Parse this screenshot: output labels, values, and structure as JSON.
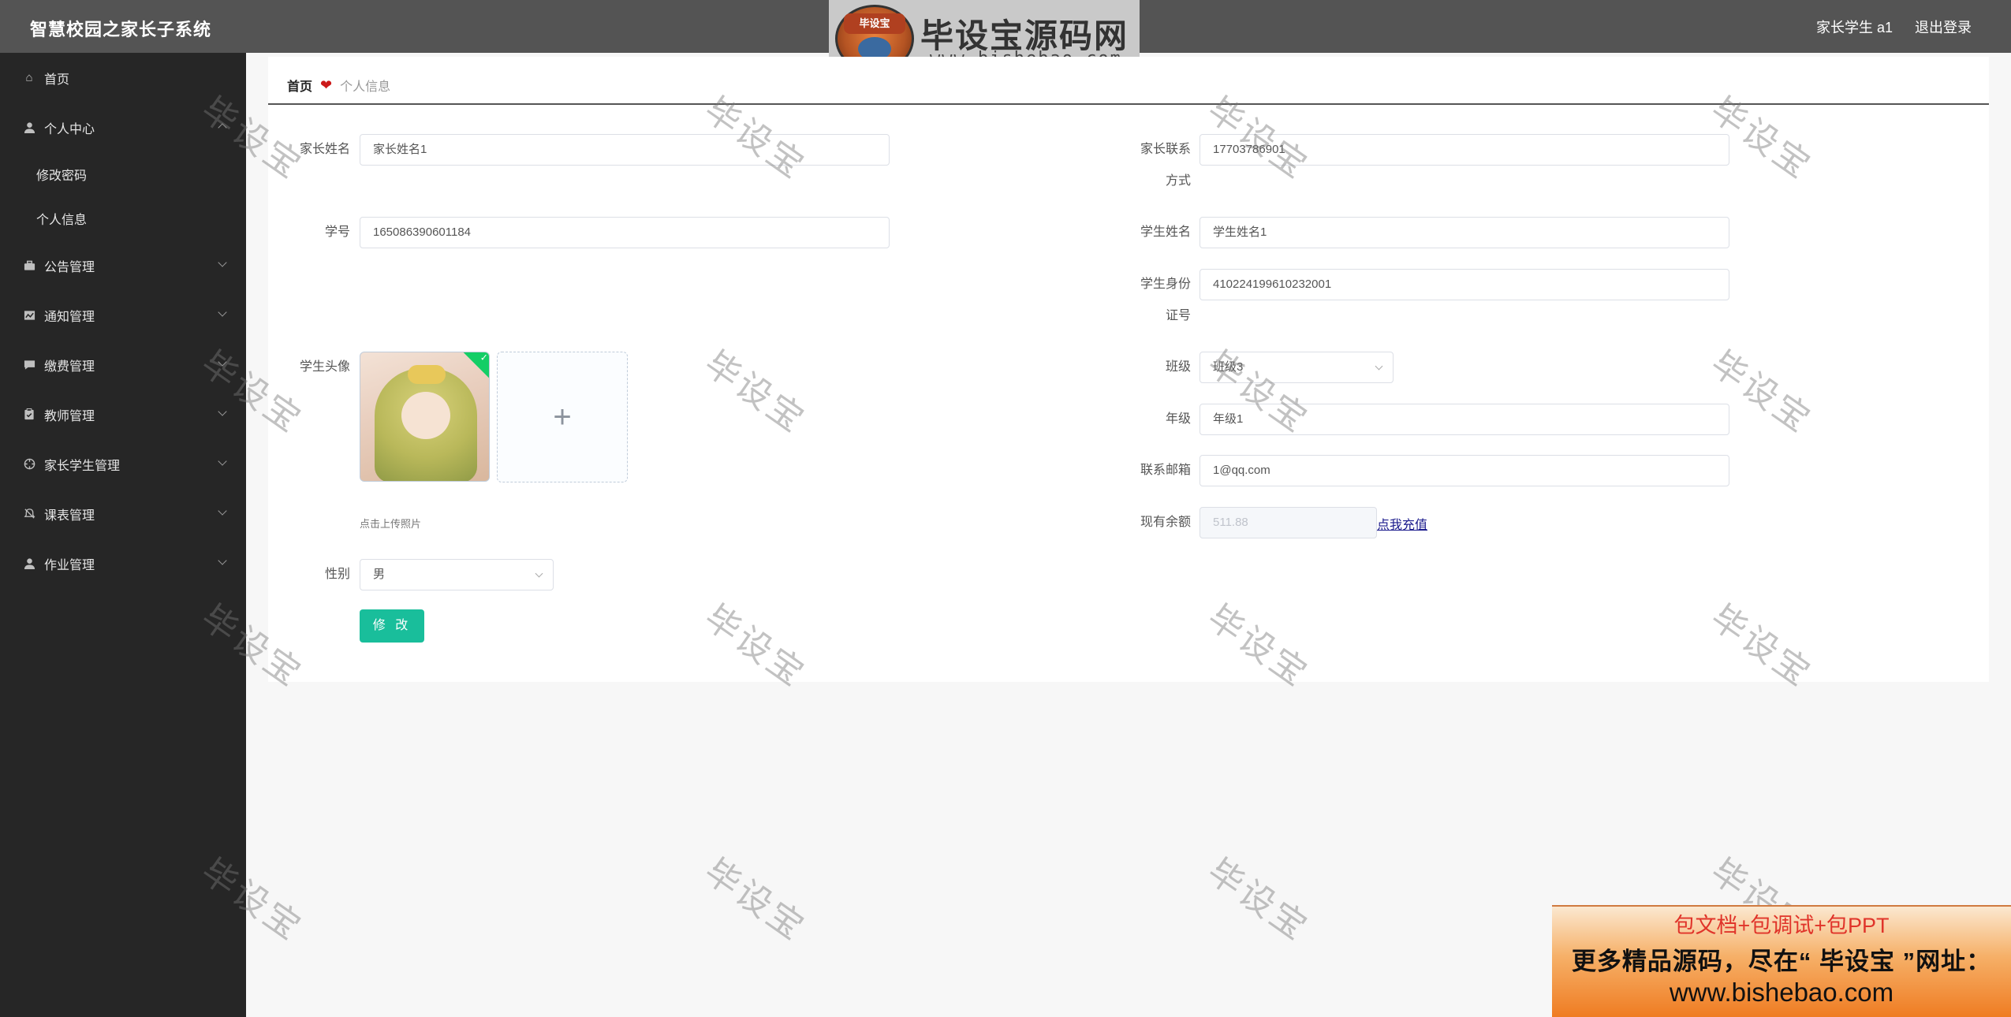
{
  "header": {
    "title": "智慧校园之家长子系统",
    "user": "家长学生 a1",
    "logout": "退出登录"
  },
  "logo": {
    "mascot_text": "毕设宝",
    "name": "毕设宝源码网",
    "url": "www.bishebao.com"
  },
  "sidebar": {
    "items": [
      {
        "label": "首页",
        "icon": "home-icon"
      },
      {
        "label": "个人中心",
        "icon": "user-icon"
      },
      {
        "label": "修改密码"
      },
      {
        "label": "个人信息"
      },
      {
        "label": "公告管理",
        "icon": "briefcase-icon"
      },
      {
        "label": "通知管理",
        "icon": "chart-icon"
      },
      {
        "label": "缴费管理",
        "icon": "chat-icon"
      },
      {
        "label": "教师管理",
        "icon": "clipboard-icon"
      },
      {
        "label": "家长学生管理",
        "icon": "crosshair-icon"
      },
      {
        "label": "课表管理",
        "icon": "bell-off-icon"
      },
      {
        "label": "作业管理",
        "icon": "user-icon"
      }
    ]
  },
  "breadcrumb": {
    "home": "首页",
    "current": "个人信息"
  },
  "form": {
    "parent_name_label": "家长姓名",
    "parent_name": "家长姓名1",
    "student_no_label": "学号",
    "student_no": "165086390601184",
    "avatar_label": "学生头像",
    "upload_hint": "点击上传照片",
    "gender_label": "性别",
    "gender": "男",
    "parent_phone_label_1": "家长联系",
    "parent_phone_label_2": "方式",
    "parent_phone": "17703786901",
    "student_name_label": "学生姓名",
    "student_name": "学生姓名1",
    "student_id_label_1": "学生身份",
    "student_id_label_2": "证号",
    "student_id": "410224199610232001",
    "class_label": "班级",
    "class": "班级3",
    "grade_label": "年级",
    "grade": "年级1",
    "email_label": "联系邮箱",
    "email": "1@qq.com",
    "balance_label": "现有余额",
    "balance": "511.88",
    "recharge": "点我充值",
    "submit": "修 改"
  },
  "watermark": "毕设宝",
  "ad": {
    "line1": "包文档+包调试+包PPT",
    "line2": "更多精品源码，尽在“ 毕设宝 ”网址：",
    "line3": "www.bishebao.com"
  },
  "colors": {
    "header_bg": "#545454",
    "sidebar_bg": "#262626",
    "accent": "#19be9b",
    "heart": "#cc1a1a"
  }
}
